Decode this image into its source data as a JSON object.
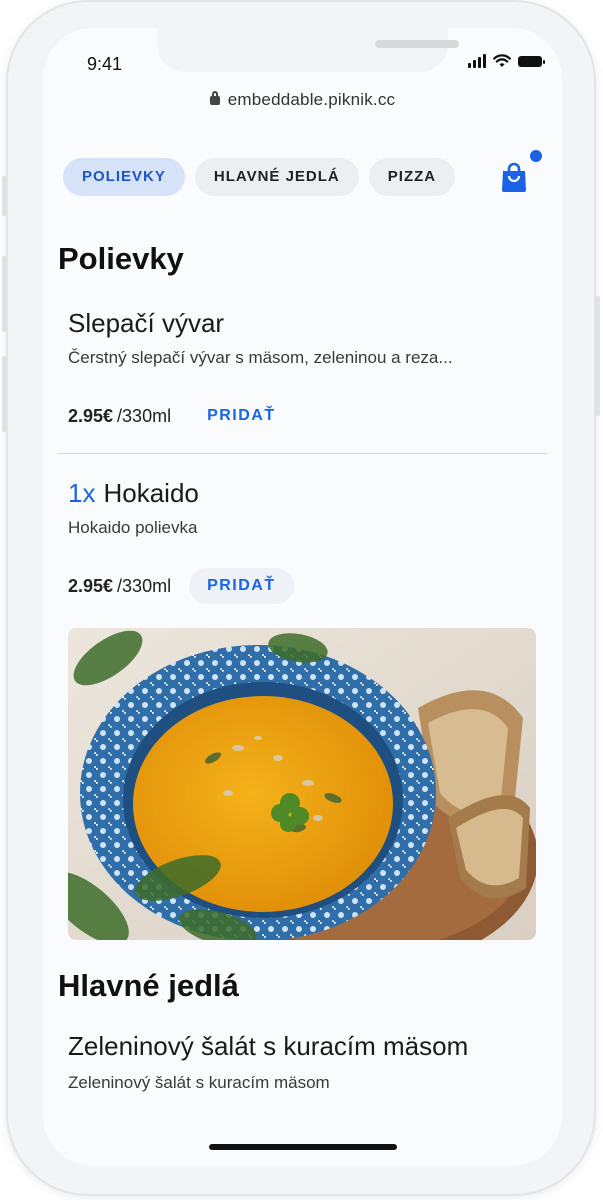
{
  "status_bar": {
    "time": "9:41"
  },
  "browser": {
    "url": "embeddable.piknik.cc"
  },
  "tabs": [
    {
      "label": "POLIEVKY",
      "active": true
    },
    {
      "label": "HLAVNÉ JEDLÁ",
      "active": false
    },
    {
      "label": "PIZZA",
      "active": false
    }
  ],
  "cart": {
    "icon": "shopping-bag-icon",
    "badge_color": "#1a62e6"
  },
  "sections": [
    {
      "title": "Polievky",
      "items": [
        {
          "name": "Slepačí vývar",
          "description": "Čerstný slepačí vývar s mäsom, zeleninou a reza...",
          "price": "2.95€",
          "unit": "/330ml",
          "add_label": "PRIDAŤ"
        },
        {
          "quantity": "1x",
          "name": "Hokaido",
          "description": "Hokaido polievka",
          "price": "2.95€",
          "unit": "/330ml",
          "add_label": "PRIDAŤ"
        }
      ]
    },
    {
      "title": "Hlavné jedlá",
      "items": [
        {
          "name": "Zeleninový šalát s kuracím mäsom",
          "description": "Zeleninový šalát s kuracím mäsom"
        }
      ]
    }
  ],
  "colors": {
    "accent": "#1a62e6",
    "active_tab_bg": "#d6e2f7"
  }
}
